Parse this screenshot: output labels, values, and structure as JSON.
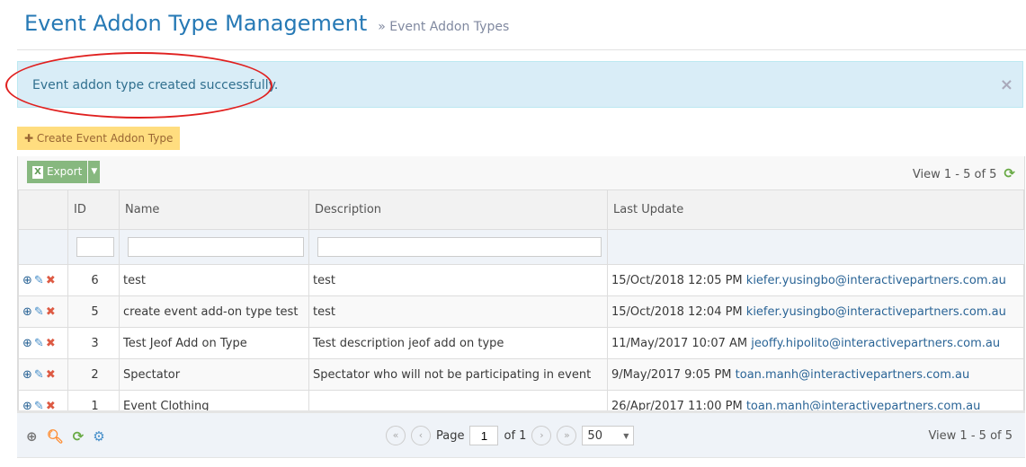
{
  "header": {
    "title": "Event Addon Type Management",
    "breadcrumb": "» Event Addon Types"
  },
  "alert": {
    "message": "Event addon type created successfully.",
    "close": "×"
  },
  "toolbar": {
    "create_label": "Create Event Addon Type",
    "export_label": "Export",
    "view_info": "View 1 - 5 of 5"
  },
  "table": {
    "columns": [
      "",
      "ID",
      "Name",
      "Description",
      "Last Update"
    ],
    "rows": [
      {
        "id": "6",
        "name": "test",
        "description": "test",
        "date": "15/Oct/2018 12:05 PM",
        "email": "kiefer.yusingbo@interactivepartners.com.au"
      },
      {
        "id": "5",
        "name": "create event add-on type test",
        "description": "test",
        "date": "15/Oct/2018 12:04 PM",
        "email": "kiefer.yusingbo@interactivepartners.com.au"
      },
      {
        "id": "3",
        "name": "Test Jeof Add on Type",
        "description": "Test description jeof add on type",
        "date": "11/May/2017 10:07 AM",
        "email": "jeoffy.hipolito@interactivepartners.com.au"
      },
      {
        "id": "2",
        "name": "Spectator",
        "description": "Spectator who will not be participating in event",
        "date": "9/May/2017 9:05 PM",
        "email": "toan.manh@interactivepartners.com.au"
      },
      {
        "id": "1",
        "name": "Event Clothing",
        "description": "",
        "date": "26/Apr/2017 11:00 PM",
        "email": "toan.manh@interactivepartners.com.au"
      }
    ]
  },
  "pager": {
    "page_label": "Page",
    "page": "1",
    "of_label": "of 1",
    "page_size": "50",
    "view_info": "View 1 - 5 of 5"
  }
}
